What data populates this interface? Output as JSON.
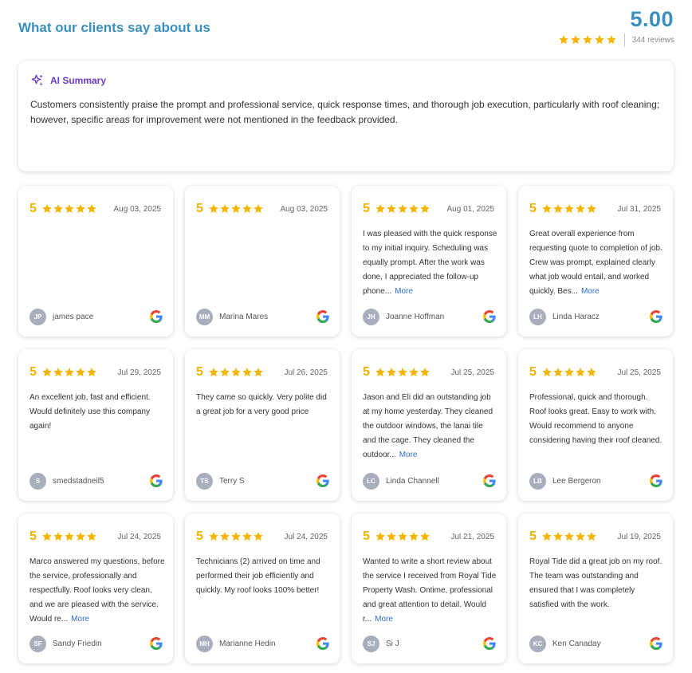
{
  "header": {
    "title": "What our clients say about us",
    "overall_score": "5.00",
    "review_count": "344 reviews",
    "star_color": "#f5b400"
  },
  "summary": {
    "label": "AI Summary",
    "text": "Customers consistently praise the prompt and professional service, quick response times, and thorough job execution, particularly with roof cleaning; however, specific areas for improvement were not mentioned in the feedback provided."
  },
  "more_label": "More",
  "reviews": [
    {
      "rating": "5",
      "date": "Aug 03, 2025",
      "text": "",
      "more": false,
      "initials": "JP",
      "name": "james pace"
    },
    {
      "rating": "5",
      "date": "Aug 03, 2025",
      "text": "",
      "more": false,
      "initials": "MM",
      "name": "Marina Mares"
    },
    {
      "rating": "5",
      "date": "Aug 01, 2025",
      "text": "I was pleased with the quick response to my initial inquiry. Scheduling was equally prompt. After the work was done, I appreciated the follow-up phone...",
      "more": true,
      "initials": "JH",
      "name": "Joanne Hoffman"
    },
    {
      "rating": "5",
      "date": "Jul 31, 2025",
      "text": "Great overall experience from requesting quote to completion of job. Crew was prompt, explained clearly what job would entail, and worked quickly. Bes...",
      "more": true,
      "initials": "LH",
      "name": "Linda Haracz"
    },
    {
      "rating": "5",
      "date": "Jul 29, 2025",
      "text": "An excellent job, fast and efficient. Would definitely use this company again!",
      "more": false,
      "initials": "S",
      "name": "smedstadneil5"
    },
    {
      "rating": "5",
      "date": "Jul 26, 2025",
      "text": "They came so quickly. Very polite did a great job for a very good price",
      "more": false,
      "initials": "TS",
      "name": "Terry S"
    },
    {
      "rating": "5",
      "date": "Jul 25, 2025",
      "text": "Jason and Eli did an outstanding job at my home yesterday. They cleaned the outdoor windows, the lanai tile and the cage. They cleaned the outdoor...",
      "more": true,
      "initials": "LC",
      "name": "Linda Channell"
    },
    {
      "rating": "5",
      "date": "Jul 25, 2025",
      "text": "Professional, quick and thorough. Roof looks great. Easy to work with. Would recommend to anyone considering having their roof cleaned.",
      "more": false,
      "initials": "LB",
      "name": "Lee Bergeron"
    },
    {
      "rating": "5",
      "date": "Jul 24, 2025",
      "text": "Marco answered my questions, before the service, professionally and respectfully. Roof looks very clean, and we are pleased with the service. Would re...",
      "more": true,
      "initials": "SF",
      "name": "Sandy Friedin"
    },
    {
      "rating": "5",
      "date": "Jul 24, 2025",
      "text": "Technicians (2) arrived on time and performed their job efficiently and quickly. My roof looks 100% better!",
      "more": false,
      "initials": "MH",
      "name": "Marianne Hedin"
    },
    {
      "rating": "5",
      "date": "Jul 21, 2025",
      "text": "Wanted to write a short review about the service I received from Royal Tide Property Wash. Ontime, professional and great attention to detail. Would r...",
      "more": true,
      "initials": "SJ",
      "name": "Si J"
    },
    {
      "rating": "5",
      "date": "Jul 19, 2025",
      "text": "Royal Tide did a great job on my roof. The team was outstanding and ensured that I was completely satisfied with the work.",
      "more": false,
      "initials": "KC",
      "name": "Ken Canaday"
    }
  ]
}
